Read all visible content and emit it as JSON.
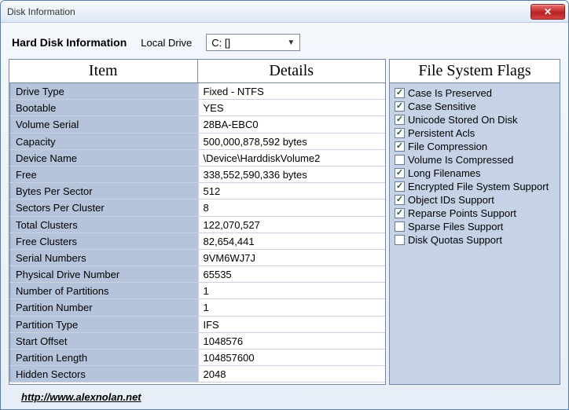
{
  "window": {
    "title": "Disk Information"
  },
  "header": {
    "hdi_label": "Hard Disk Information",
    "local_drive_label": "Local Drive",
    "selected_drive": "C: []"
  },
  "columns": {
    "item": "Item",
    "details": "Details"
  },
  "rows": [
    {
      "item": "Drive Type",
      "detail": "Fixed - NTFS"
    },
    {
      "item": "Bootable",
      "detail": "YES"
    },
    {
      "item": "Volume Serial",
      "detail": "28BA-EBC0"
    },
    {
      "item": "Capacity",
      "detail": "500,000,878,592 bytes"
    },
    {
      "item": "Device Name",
      "detail": "\\Device\\HarddiskVolume2"
    },
    {
      "item": "Free",
      "detail": "338,552,590,336 bytes"
    },
    {
      "item": "Bytes Per Sector",
      "detail": "512"
    },
    {
      "item": "Sectors Per Cluster",
      "detail": "8"
    },
    {
      "item": "Total Clusters",
      "detail": "122,070,527"
    },
    {
      "item": "Free Clusters",
      "detail": "82,654,441"
    },
    {
      "item": "Serial Numbers",
      "detail": "9VM6WJ7J"
    },
    {
      "item": "Physical Drive Number",
      "detail": "65535"
    },
    {
      "item": "Number of Partitions",
      "detail": "1"
    },
    {
      "item": "Partition Number",
      "detail": "1"
    },
    {
      "item": "Partition Type",
      "detail": "IFS"
    },
    {
      "item": "Start Offset",
      "detail": "1048576"
    },
    {
      "item": "Partition Length",
      "detail": "104857600"
    },
    {
      "item": "Hidden Sectors",
      "detail": "2048"
    }
  ],
  "flags_header": "File System Flags",
  "flags": [
    {
      "label": "Case Is Preserved",
      "checked": true
    },
    {
      "label": "Case Sensitive",
      "checked": true
    },
    {
      "label": "Unicode Stored On Disk",
      "checked": true
    },
    {
      "label": "Persistent Acls",
      "checked": true
    },
    {
      "label": "File Compression",
      "checked": true
    },
    {
      "label": "Volume Is Compressed",
      "checked": false
    },
    {
      "label": "Long Filenames",
      "checked": true
    },
    {
      "label": "Encrypted File System Support",
      "checked": true
    },
    {
      "label": "Object IDs Support",
      "checked": true
    },
    {
      "label": "Reparse Points Support",
      "checked": true
    },
    {
      "label": "Sparse Files Support",
      "checked": false
    },
    {
      "label": "Disk Quotas Support",
      "checked": false
    }
  ],
  "footer": {
    "link_text": "http://www.alexnolan.net"
  }
}
